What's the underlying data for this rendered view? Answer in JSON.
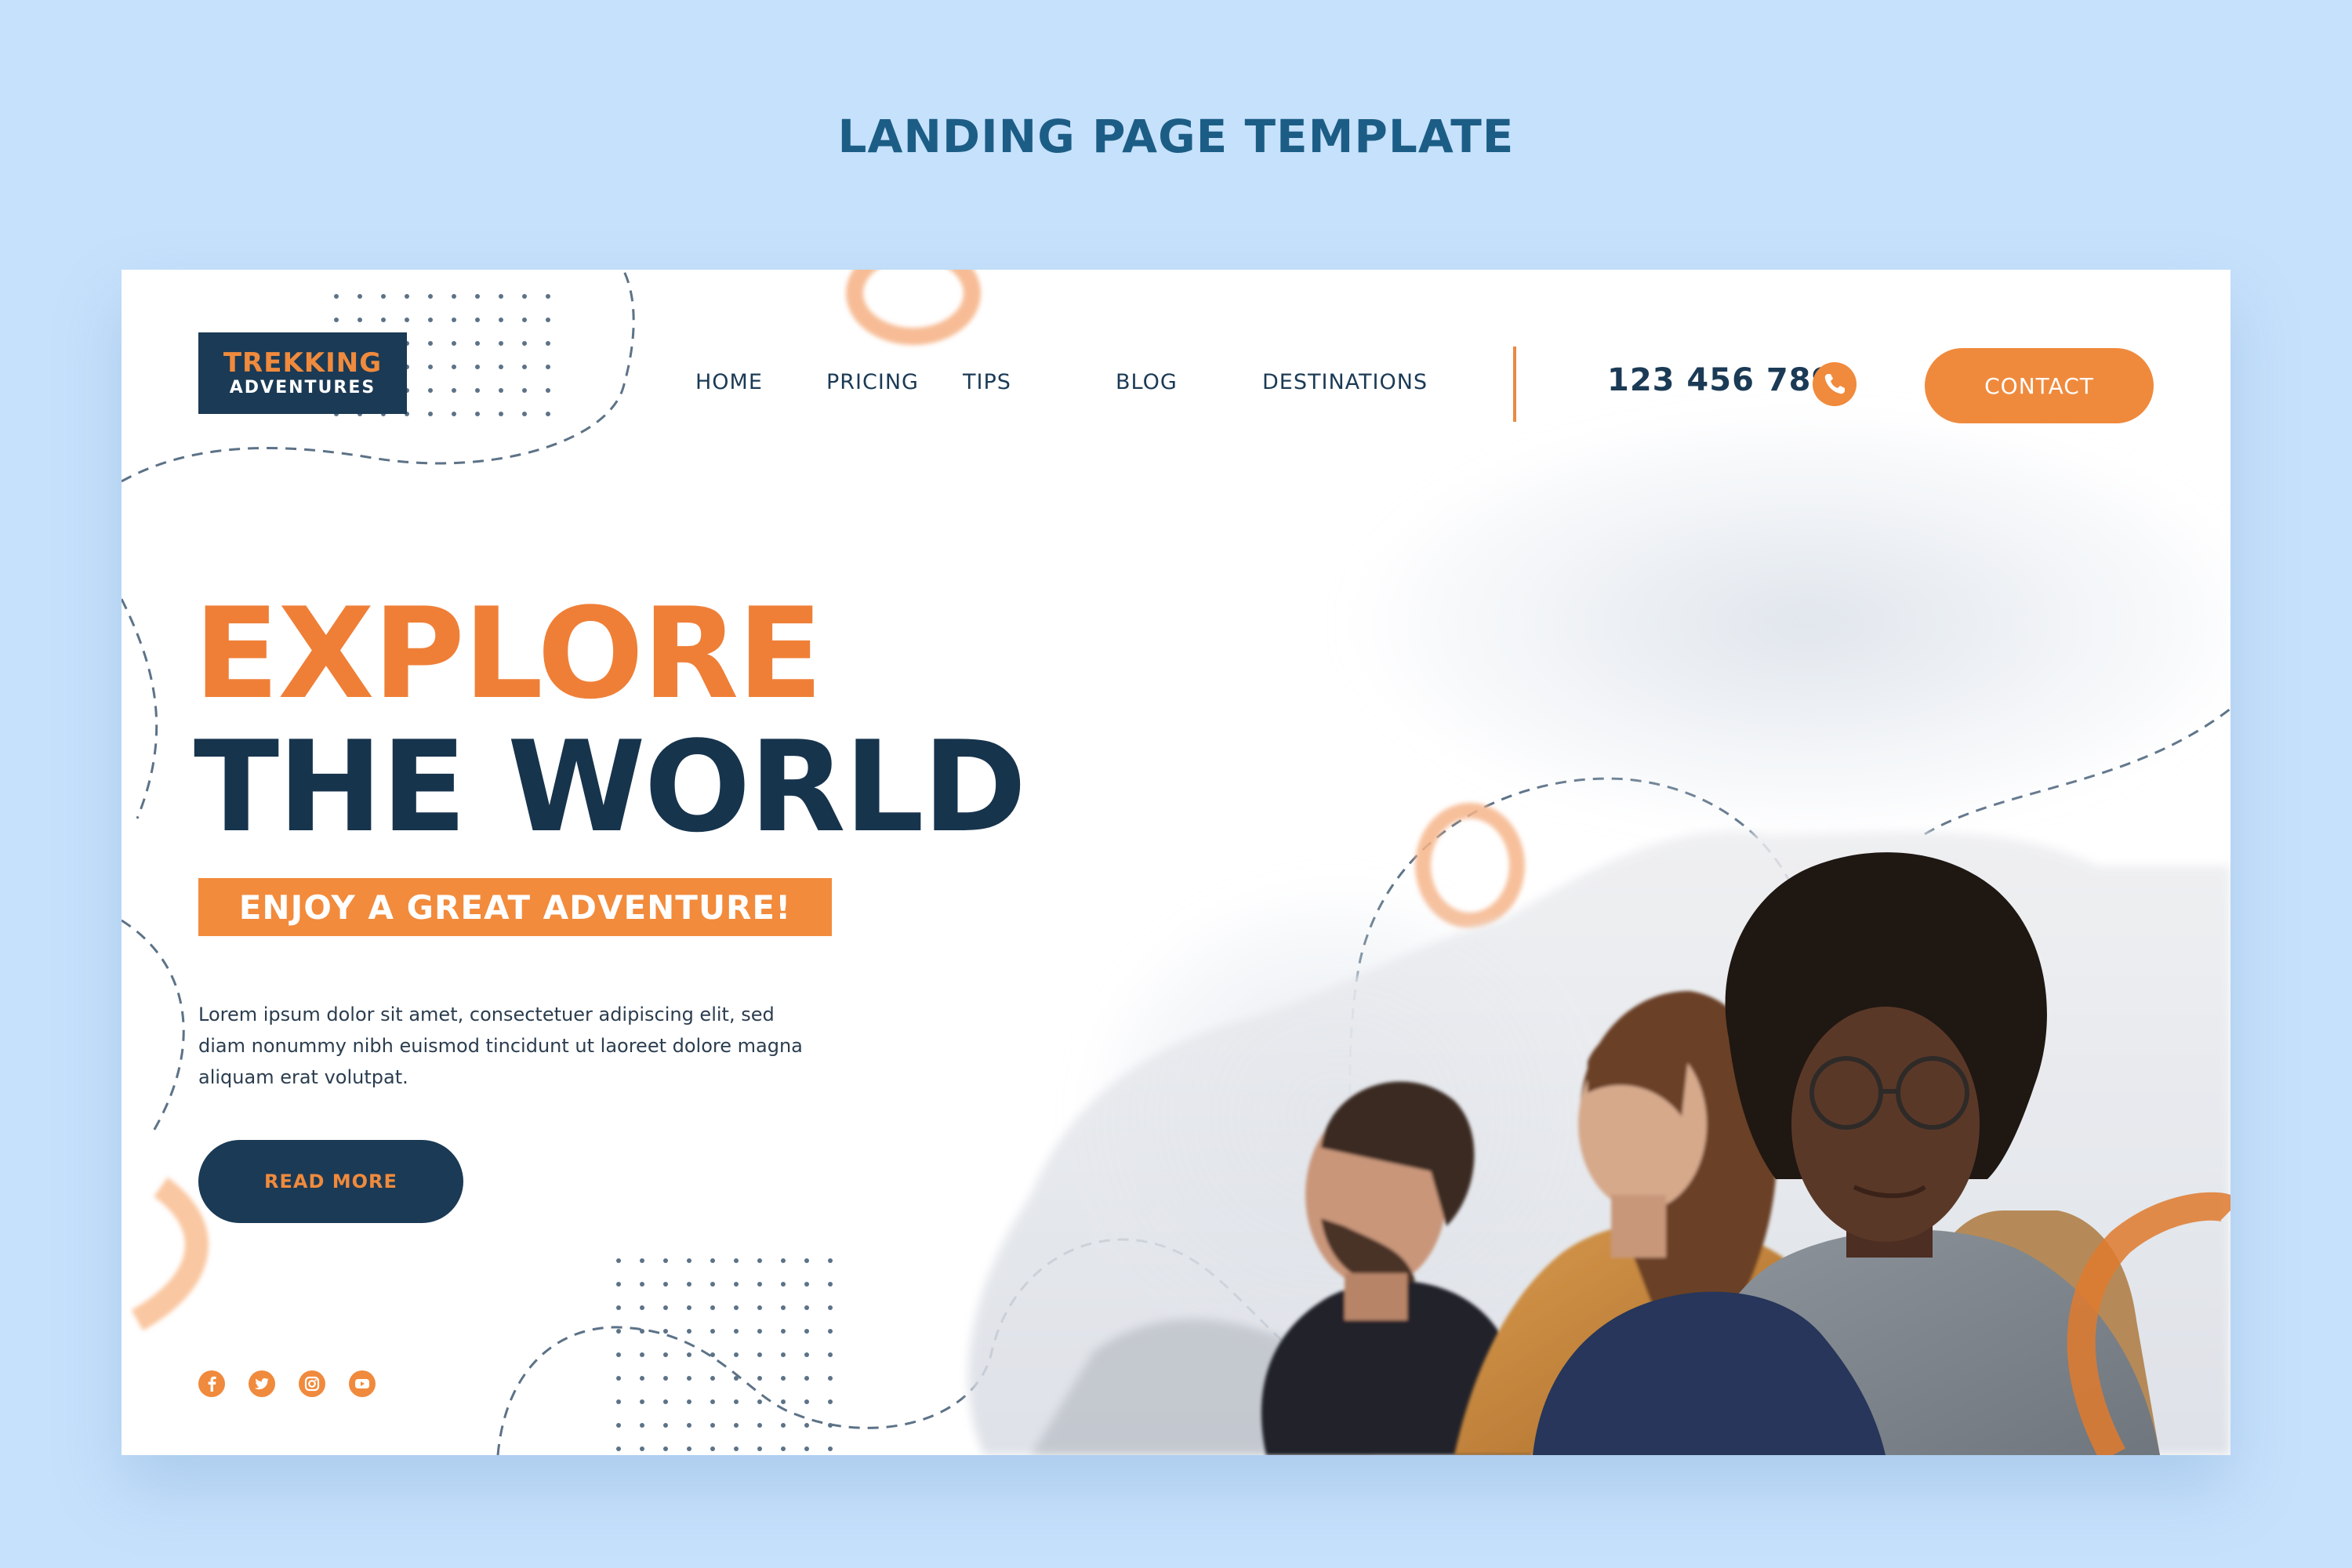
{
  "page": {
    "template_title": "LANDING PAGE TEMPLATE"
  },
  "brand": {
    "title": "TREKKING",
    "subtitle": "ADVENTURES"
  },
  "nav": {
    "items": [
      {
        "label": "HOME"
      },
      {
        "label": "PRICING"
      },
      {
        "label": "TIPS"
      },
      {
        "label": "BLOG"
      },
      {
        "label": "DESTINATIONS"
      }
    ]
  },
  "header": {
    "phone": "123 456 789",
    "phone_icon": "phone-icon",
    "contact_label": "CONTACT"
  },
  "hero": {
    "headline_line1": "EXPLORE",
    "headline_line2": "THE WORLD",
    "tagline": "ENJOY A GREAT ADVENTURE!",
    "body": "Lorem ipsum dolor sit amet, consectetuer adipiscing elit, sed diam nonummy nibh euismod tincidunt ut laoreet dolore magna aliquam erat volutpat.",
    "cta_label": "READ MORE"
  },
  "socials": [
    {
      "icon": "facebook-icon"
    },
    {
      "icon": "twitter-icon"
    },
    {
      "icon": "instagram-icon"
    },
    {
      "icon": "youtube-icon"
    }
  ],
  "colors": {
    "background": "#c6e1fb",
    "navy": "#1b3a55",
    "orange": "#ef8a3d",
    "title_blue": "#1c5d86"
  }
}
